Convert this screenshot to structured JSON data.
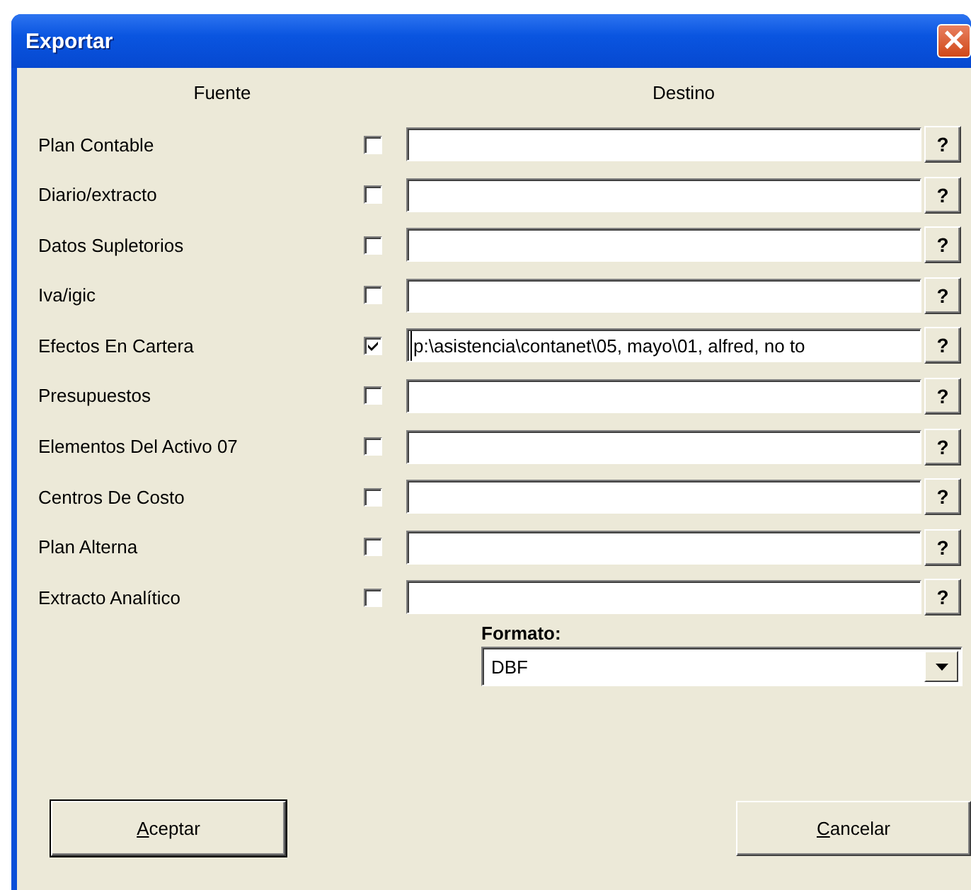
{
  "window": {
    "title": "Exportar",
    "close_icon": "×"
  },
  "headers": {
    "source": "Fuente",
    "destination": "Destino"
  },
  "rows": [
    {
      "label": "Plan Contable",
      "checked": false,
      "path": "",
      "help": "?"
    },
    {
      "label": "Diario/extracto",
      "checked": false,
      "path": "",
      "help": "?"
    },
    {
      "label": "Datos Supletorios",
      "checked": false,
      "path": "",
      "help": "?"
    },
    {
      "label": "Iva/igic",
      "checked": false,
      "path": "",
      "help": "?"
    },
    {
      "label": "Efectos En Cartera",
      "checked": true,
      "path": "p:\\asistencia\\contanet\\05, mayo\\01, alfred, no to",
      "help": "?"
    },
    {
      "label": "Presupuestos",
      "checked": false,
      "path": "",
      "help": "?"
    },
    {
      "label": "Elementos Del Activo 07",
      "checked": false,
      "path": "",
      "help": "?"
    },
    {
      "label": "Centros De Costo",
      "checked": false,
      "path": "",
      "help": "?"
    },
    {
      "label": "Plan Alterna",
      "checked": false,
      "path": "",
      "help": "?"
    },
    {
      "label": "Extracto Analítico",
      "checked": false,
      "path": "",
      "help": "?"
    }
  ],
  "format": {
    "label": "Formato:",
    "value": "DBF"
  },
  "buttons": [
    {
      "label": "Aceptar",
      "access_key_underlined": true
    },
    {
      "label": "Cancelar",
      "access_key_underlined": true
    }
  ]
}
